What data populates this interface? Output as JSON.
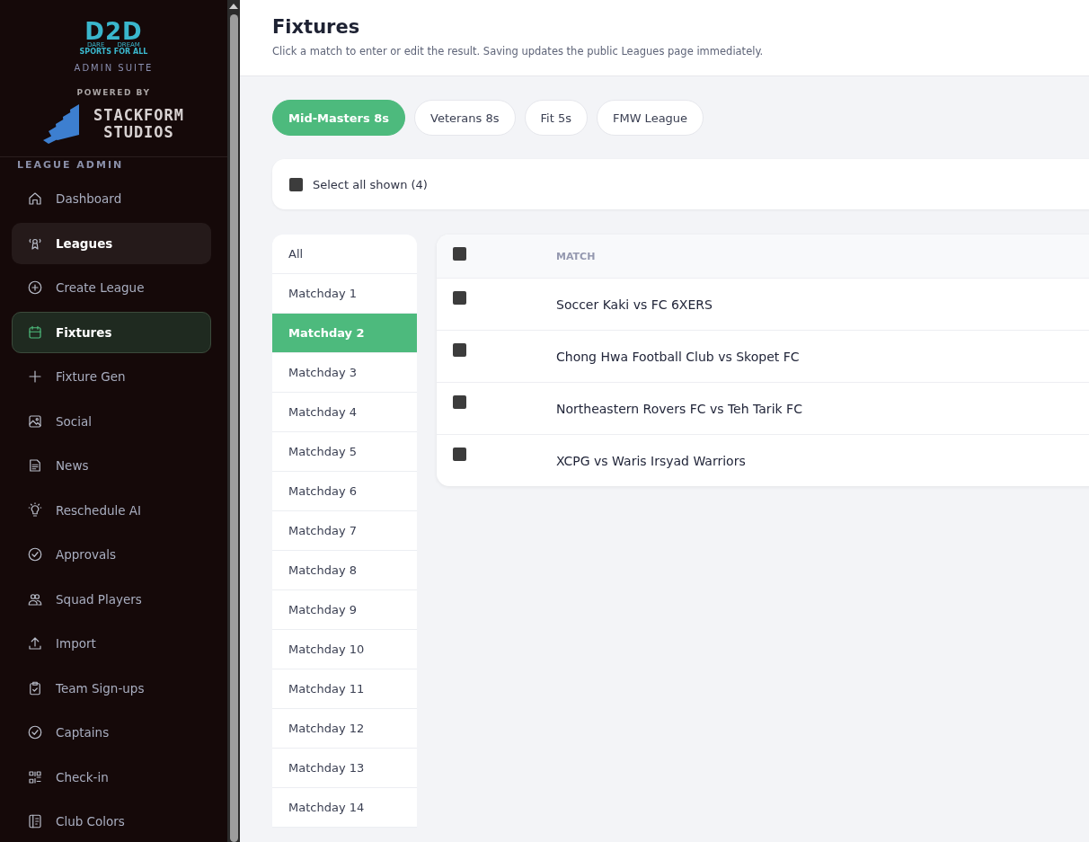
{
  "brand": {
    "logo_mark": "D2D",
    "logo_left": "DARE",
    "logo_right": "DREAM",
    "logo_tagline": "SPORTS FOR ALL",
    "suite": "ADMIN SUITE",
    "powered_by": "POWERED BY",
    "partner_line1": "STACKFORM",
    "partner_line2": "STUDIOS"
  },
  "sidebar": {
    "section": "LEAGUE ADMIN",
    "items": [
      {
        "label": "Dashboard",
        "selected": false,
        "highlighted": false
      },
      {
        "label": "Leagues",
        "selected": false,
        "highlighted": true
      },
      {
        "label": "Create League",
        "selected": false,
        "highlighted": false
      },
      {
        "label": "Fixtures",
        "selected": true,
        "highlighted": false
      },
      {
        "label": "Fixture Gen",
        "selected": false,
        "highlighted": false
      },
      {
        "label": "Social",
        "selected": false,
        "highlighted": false
      },
      {
        "label": "News",
        "selected": false,
        "highlighted": false
      },
      {
        "label": "Reschedule AI",
        "selected": false,
        "highlighted": false
      },
      {
        "label": "Approvals",
        "selected": false,
        "highlighted": false
      },
      {
        "label": "Squad Players",
        "selected": false,
        "highlighted": false
      },
      {
        "label": "Import",
        "selected": false,
        "highlighted": false
      },
      {
        "label": "Team Sign-ups",
        "selected": false,
        "highlighted": false
      },
      {
        "label": "Captains",
        "selected": false,
        "highlighted": false
      },
      {
        "label": "Check-in",
        "selected": false,
        "highlighted": false
      },
      {
        "label": "Club Colors",
        "selected": false,
        "highlighted": false
      }
    ]
  },
  "header": {
    "title": "Fixtures",
    "subtitle": "Click a match to enter or edit the result. Saving updates the public Leagues page immediately."
  },
  "league_tabs": [
    {
      "label": "Mid-Masters 8s",
      "selected": true
    },
    {
      "label": "Veterans 8s",
      "selected": false
    },
    {
      "label": "Fit 5s",
      "selected": false
    },
    {
      "label": "FMW League",
      "selected": false
    }
  ],
  "select_all": {
    "label": "Select all shown (4)",
    "checked": false
  },
  "matchdays": [
    {
      "label": "All",
      "selected": false
    },
    {
      "label": "Matchday 1",
      "selected": false
    },
    {
      "label": "Matchday 2",
      "selected": true
    },
    {
      "label": "Matchday 3",
      "selected": false
    },
    {
      "label": "Matchday 4",
      "selected": false
    },
    {
      "label": "Matchday 5",
      "selected": false
    },
    {
      "label": "Matchday 6",
      "selected": false
    },
    {
      "label": "Matchday 7",
      "selected": false
    },
    {
      "label": "Matchday 8",
      "selected": false
    },
    {
      "label": "Matchday 9",
      "selected": false
    },
    {
      "label": "Matchday 10",
      "selected": false
    },
    {
      "label": "Matchday 11",
      "selected": false
    },
    {
      "label": "Matchday 12",
      "selected": false
    },
    {
      "label": "Matchday 13",
      "selected": false
    },
    {
      "label": "Matchday 14",
      "selected": false
    }
  ],
  "table": {
    "header_checked": false,
    "columns": [
      "MATCH"
    ],
    "rows": [
      {
        "match": "Soccer Kaki vs FC 6XERS",
        "checked": false
      },
      {
        "match": "Chong Hwa Football Club vs Skopet FC",
        "checked": false
      },
      {
        "match": "Northeastern Rovers FC vs Teh Tarik FC",
        "checked": false
      },
      {
        "match": "XCPG vs Waris Irsyad Warriors",
        "checked": false
      }
    ]
  }
}
